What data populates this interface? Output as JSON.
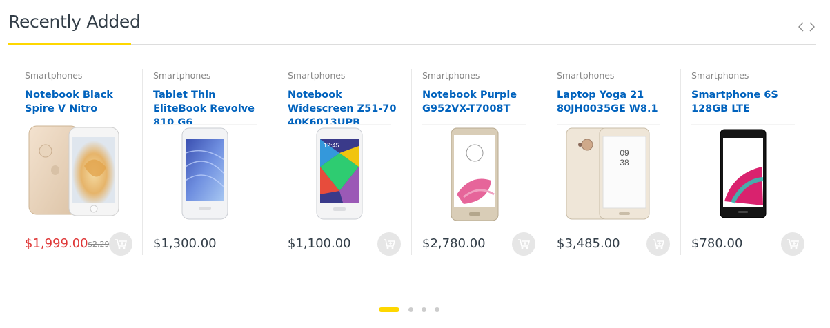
{
  "section": {
    "title": "Recently Added"
  },
  "icons": {
    "prev": "chevron-left-icon",
    "next": "chevron-right-icon",
    "cart": "add-to-cart-icon"
  },
  "colors": {
    "accent": "#fed700",
    "link": "#0062bd",
    "sale_price": "#df3737",
    "text": "#333e48"
  },
  "products": [
    {
      "category": "Smartphones",
      "name": "Notebook Black Spire V Nitro",
      "price": "$1,999.00",
      "old_price": "$2,29",
      "sale": true
    },
    {
      "category": "Smartphones",
      "name": "Tablet Thin EliteBook Revolve 810 G6",
      "price": "$1,300.00"
    },
    {
      "category": "Smartphones",
      "name": "Notebook Widescreen Z51-70 40K6013UPB",
      "price": "$1,100.00"
    },
    {
      "category": "Smartphones",
      "name": "Notebook Purple G952VX-T7008T",
      "price": "$2,780.00"
    },
    {
      "category": "Smartphones",
      "name": "Laptop Yoga 21 80JH0035GE W8.1",
      "price": "$3,485.00"
    },
    {
      "category": "Smartphones",
      "name": "Smartphone 6S 128GB LTE",
      "price": "$780.00"
    }
  ],
  "phone_screens": {
    "p2_time": "12:45",
    "p4_time": "09",
    "p4_min": "38"
  },
  "pagination": {
    "total": 4,
    "active": 1
  }
}
